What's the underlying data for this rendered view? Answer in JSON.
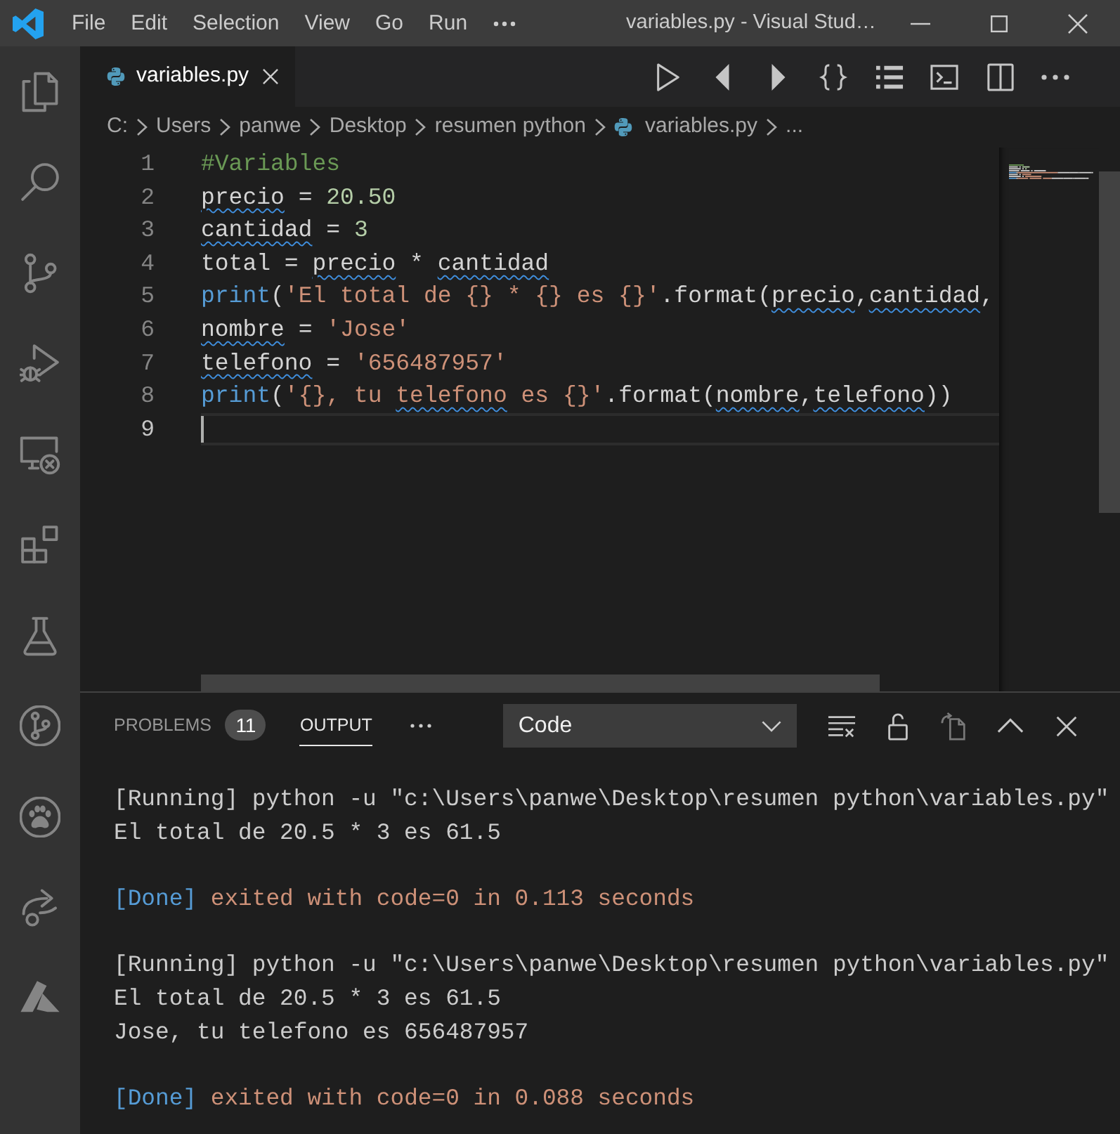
{
  "title_bar": {
    "menu": [
      "File",
      "Edit",
      "Selection",
      "View",
      "Go",
      "Run"
    ],
    "title": "variables.py - Visual Stud…"
  },
  "editor": {
    "tabs": [
      {
        "label": "variables.py",
        "selected": true
      }
    ],
    "breadcrumbs": [
      {
        "label": "C:",
        "kind": "folder"
      },
      {
        "label": "Users",
        "kind": "folder"
      },
      {
        "label": "panwe",
        "kind": "folder"
      },
      {
        "label": "Desktop",
        "kind": "folder"
      },
      {
        "label": "resumen python",
        "kind": "folder"
      },
      {
        "label": "variables.py",
        "kind": "file"
      },
      {
        "label": "...",
        "kind": "symbol"
      }
    ],
    "lines": [
      {
        "number": "1",
        "current": false,
        "tokens": [
          {
            "text": "#Variables",
            "kind": "comment",
            "flagged": false
          }
        ]
      },
      {
        "number": "2",
        "current": false,
        "tokens": [
          {
            "text": "precio",
            "kind": "plain",
            "flagged": true
          },
          {
            "text": " = ",
            "kind": "plain",
            "flagged": false
          },
          {
            "text": "20.50",
            "kind": "number",
            "flagged": false
          }
        ]
      },
      {
        "number": "3",
        "current": false,
        "tokens": [
          {
            "text": "cantidad",
            "kind": "plain",
            "flagged": true
          },
          {
            "text": " = ",
            "kind": "plain",
            "flagged": false
          },
          {
            "text": "3",
            "kind": "number",
            "flagged": false
          }
        ]
      },
      {
        "number": "4",
        "current": false,
        "tokens": [
          {
            "text": "total = ",
            "kind": "plain",
            "flagged": false
          },
          {
            "text": "precio",
            "kind": "plain",
            "flagged": true
          },
          {
            "text": " * ",
            "kind": "plain",
            "flagged": false
          },
          {
            "text": "cantidad",
            "kind": "plain",
            "flagged": true
          }
        ]
      },
      {
        "number": "5",
        "current": false,
        "tokens": [
          {
            "text": "print",
            "kind": "function",
            "flagged": false
          },
          {
            "text": "(",
            "kind": "plain",
            "flagged": false
          },
          {
            "text": "'El total de {} * {} es {}'",
            "kind": "string",
            "flagged": false
          },
          {
            "text": ".format(",
            "kind": "plain",
            "flagged": false
          },
          {
            "text": "precio",
            "kind": "plain",
            "flagged": true
          },
          {
            "text": ",",
            "kind": "plain",
            "flagged": false
          },
          {
            "text": "cantidad",
            "kind": "plain",
            "flagged": true
          },
          {
            "text": ",",
            "kind": "plain",
            "flagged": false
          }
        ]
      },
      {
        "number": "6",
        "current": false,
        "tokens": [
          {
            "text": "nombre",
            "kind": "plain",
            "flagged": true
          },
          {
            "text": " = ",
            "kind": "plain",
            "flagged": false
          },
          {
            "text": "'Jose'",
            "kind": "string",
            "flagged": false
          }
        ]
      },
      {
        "number": "7",
        "current": false,
        "tokens": [
          {
            "text": "telefono",
            "kind": "plain",
            "flagged": true
          },
          {
            "text": " = ",
            "kind": "plain",
            "flagged": false
          },
          {
            "text": "'656487957'",
            "kind": "string",
            "flagged": false
          }
        ]
      },
      {
        "number": "8",
        "current": false,
        "tokens": [
          {
            "text": "print",
            "kind": "function",
            "flagged": false
          },
          {
            "text": "(",
            "kind": "plain",
            "flagged": false
          },
          {
            "text": "'{}, tu ",
            "kind": "string",
            "flagged": false
          },
          {
            "text": "telefono",
            "kind": "string",
            "flagged": true
          },
          {
            "text": " es {}'",
            "kind": "string",
            "flagged": false
          },
          {
            "text": ".format(",
            "kind": "plain",
            "flagged": false
          },
          {
            "text": "nombre",
            "kind": "plain",
            "flagged": true
          },
          {
            "text": ",",
            "kind": "plain",
            "flagged": false
          },
          {
            "text": "telefono",
            "kind": "plain",
            "flagged": true
          },
          {
            "text": "))",
            "kind": "plain",
            "flagged": false
          }
        ]
      },
      {
        "number": "9",
        "current": true
      }
    ]
  },
  "panel": {
    "tabs": [
      {
        "label": "PROBLEMS",
        "badge": "11",
        "selected": false
      },
      {
        "label": "OUTPUT",
        "selected": true
      }
    ],
    "channel": {
      "value": "Code"
    },
    "output": [
      {
        "kind": "text",
        "text": "[Running] python -u \"c:\\Users\\panwe\\Desktop\\resumen python\\variables.py\""
      },
      {
        "kind": "text",
        "text": "El total de 20.5 * 3 es 61.5"
      },
      {
        "kind": "blank"
      },
      {
        "kind": "status",
        "label": "[Done]",
        "message": "exited with code=0 in 0.113 seconds"
      },
      {
        "kind": "blank"
      },
      {
        "kind": "text",
        "text": "[Running] python -u \"c:\\Users\\panwe\\Desktop\\resumen python\\variables.py\""
      },
      {
        "kind": "text",
        "text": "El total de 20.5 * 3 es 61.5"
      },
      {
        "kind": "text",
        "text": "Jose, tu telefono es 656487957"
      },
      {
        "kind": "blank"
      },
      {
        "kind": "status",
        "label": "[Done]",
        "message": "exited with code=0 in 0.088 seconds"
      }
    ]
  }
}
